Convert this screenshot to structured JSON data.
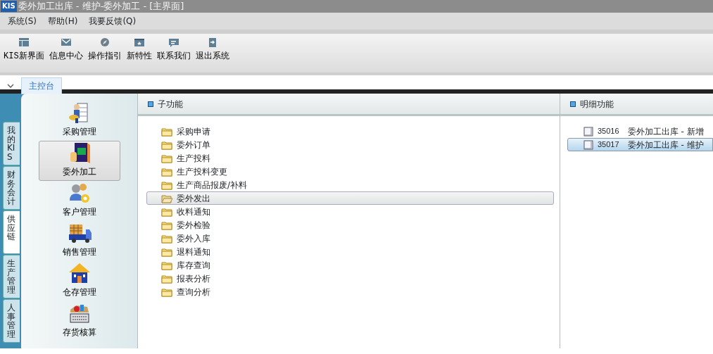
{
  "window": {
    "logo": "KIS",
    "title": "委外加工出库 - 维护-委外加工 - [主界面]"
  },
  "menu": [
    "系统(S)",
    "帮助(H)",
    "我要反馈(Q)"
  ],
  "toolbar": [
    "KIS新界面",
    "信息中心",
    "操作指引",
    "新特性",
    "联系我们",
    "退出系统"
  ],
  "tabs": [
    {
      "label": "主控台",
      "selected": true
    }
  ],
  "side_tabs": [
    {
      "label": "我的KIS",
      "selected": false
    },
    {
      "label": "财务会计",
      "selected": false
    },
    {
      "label": "供应链",
      "selected": true
    },
    {
      "label": "生产管理",
      "selected": false
    },
    {
      "label": "人事管理",
      "selected": false
    }
  ],
  "modules": [
    {
      "label": "采购管理",
      "selected": false
    },
    {
      "label": "委外加工",
      "selected": true
    },
    {
      "label": "客户管理",
      "selected": false
    },
    {
      "label": "销售管理",
      "selected": false
    },
    {
      "label": "仓存管理",
      "selected": false
    },
    {
      "label": "存货核算",
      "selected": false
    }
  ],
  "subfunctions": {
    "title": "子功能",
    "items": [
      {
        "label": "采购申请",
        "selected": false
      },
      {
        "label": "委外订单",
        "selected": false
      },
      {
        "label": "生产投料",
        "selected": false
      },
      {
        "label": "生产投料变更",
        "selected": false
      },
      {
        "label": "生产商品报废/补料",
        "selected": false
      },
      {
        "label": "委外发出",
        "selected": true
      },
      {
        "label": "收料通知",
        "selected": false
      },
      {
        "label": "委外检验",
        "selected": false
      },
      {
        "label": "委外入库",
        "selected": false
      },
      {
        "label": "退料通知",
        "selected": false
      },
      {
        "label": "库存查询",
        "selected": false
      },
      {
        "label": "报表分析",
        "selected": false
      },
      {
        "label": "查询分析",
        "selected": false
      }
    ]
  },
  "details": {
    "title": "明细功能",
    "items": [
      {
        "code": "35016",
        "label": "委外加工出库 - 新增",
        "selected": false
      },
      {
        "code": "35017",
        "label": "委外加工出库 - 维护",
        "selected": true
      }
    ]
  }
}
